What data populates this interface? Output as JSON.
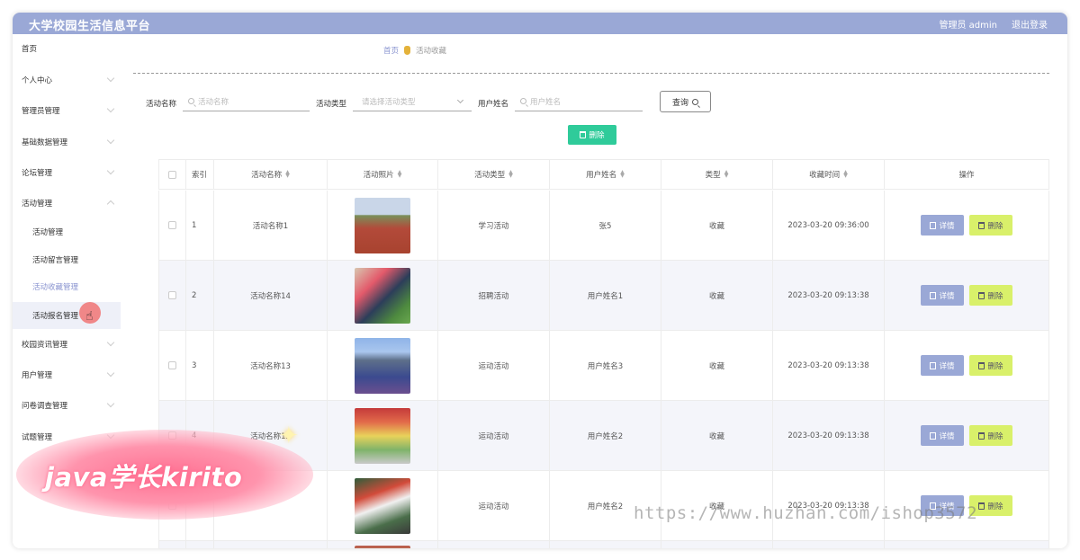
{
  "app": {
    "title": "大学校园生活信息平台",
    "admin_label": "管理员 admin",
    "logout": "退出登录"
  },
  "sidebar": {
    "items": [
      {
        "label": "首页"
      },
      {
        "label": "个人中心"
      },
      {
        "label": "管理员管理"
      },
      {
        "label": "基础数据管理"
      },
      {
        "label": "论坛管理"
      },
      {
        "label": "活动管理"
      },
      {
        "label": "活动管理"
      },
      {
        "label": "活动留言管理"
      },
      {
        "label": "活动收藏管理"
      },
      {
        "label": "活动报名管理"
      },
      {
        "label": "校园资讯管理"
      },
      {
        "label": "用户管理"
      },
      {
        "label": "问卷调查管理"
      },
      {
        "label": "试题管理"
      }
    ]
  },
  "breadcrumb": {
    "home": "首页",
    "current": "活动收藏"
  },
  "filters": {
    "name_label": "活动名称",
    "name_placeholder": "活动名称",
    "type_label": "活动类型",
    "type_placeholder": "请选择活动类型",
    "user_label": "用户姓名",
    "user_placeholder": "用户姓名",
    "query": "查询"
  },
  "bulk_delete": "删除",
  "table": {
    "headers": [
      "索引",
      "活动名称",
      "活动照片",
      "活动类型",
      "用户姓名",
      "类型",
      "收藏时间",
      "操作"
    ],
    "detail_label": "详情",
    "delete_label": "删除",
    "rows": [
      {
        "index": "1",
        "name": "活动名称1",
        "type": "学习活动",
        "user": "张5",
        "kind": "收藏",
        "time": "2023-03-20 09:36:00"
      },
      {
        "index": "2",
        "name": "活动名称14",
        "type": "招聘活动",
        "user": "用户姓名1",
        "kind": "收藏",
        "time": "2023-03-20 09:13:38"
      },
      {
        "index": "3",
        "name": "活动名称13",
        "type": "运动活动",
        "user": "用户姓名3",
        "kind": "收藏",
        "time": "2023-03-20 09:13:38"
      },
      {
        "index": "4",
        "name": "活动名称12",
        "type": "运动活动",
        "user": "用户姓名2",
        "kind": "收藏",
        "time": "2023-03-20 09:13:38"
      },
      {
        "index": "",
        "name": "",
        "type": "运动活动",
        "user": "用户姓名2",
        "kind": "收藏",
        "time": "2023-03-20 09:13:38"
      }
    ]
  },
  "overlay": {
    "promo": "java学长kirito",
    "watermark": "https://www.huzhan.com/ishop3572"
  }
}
